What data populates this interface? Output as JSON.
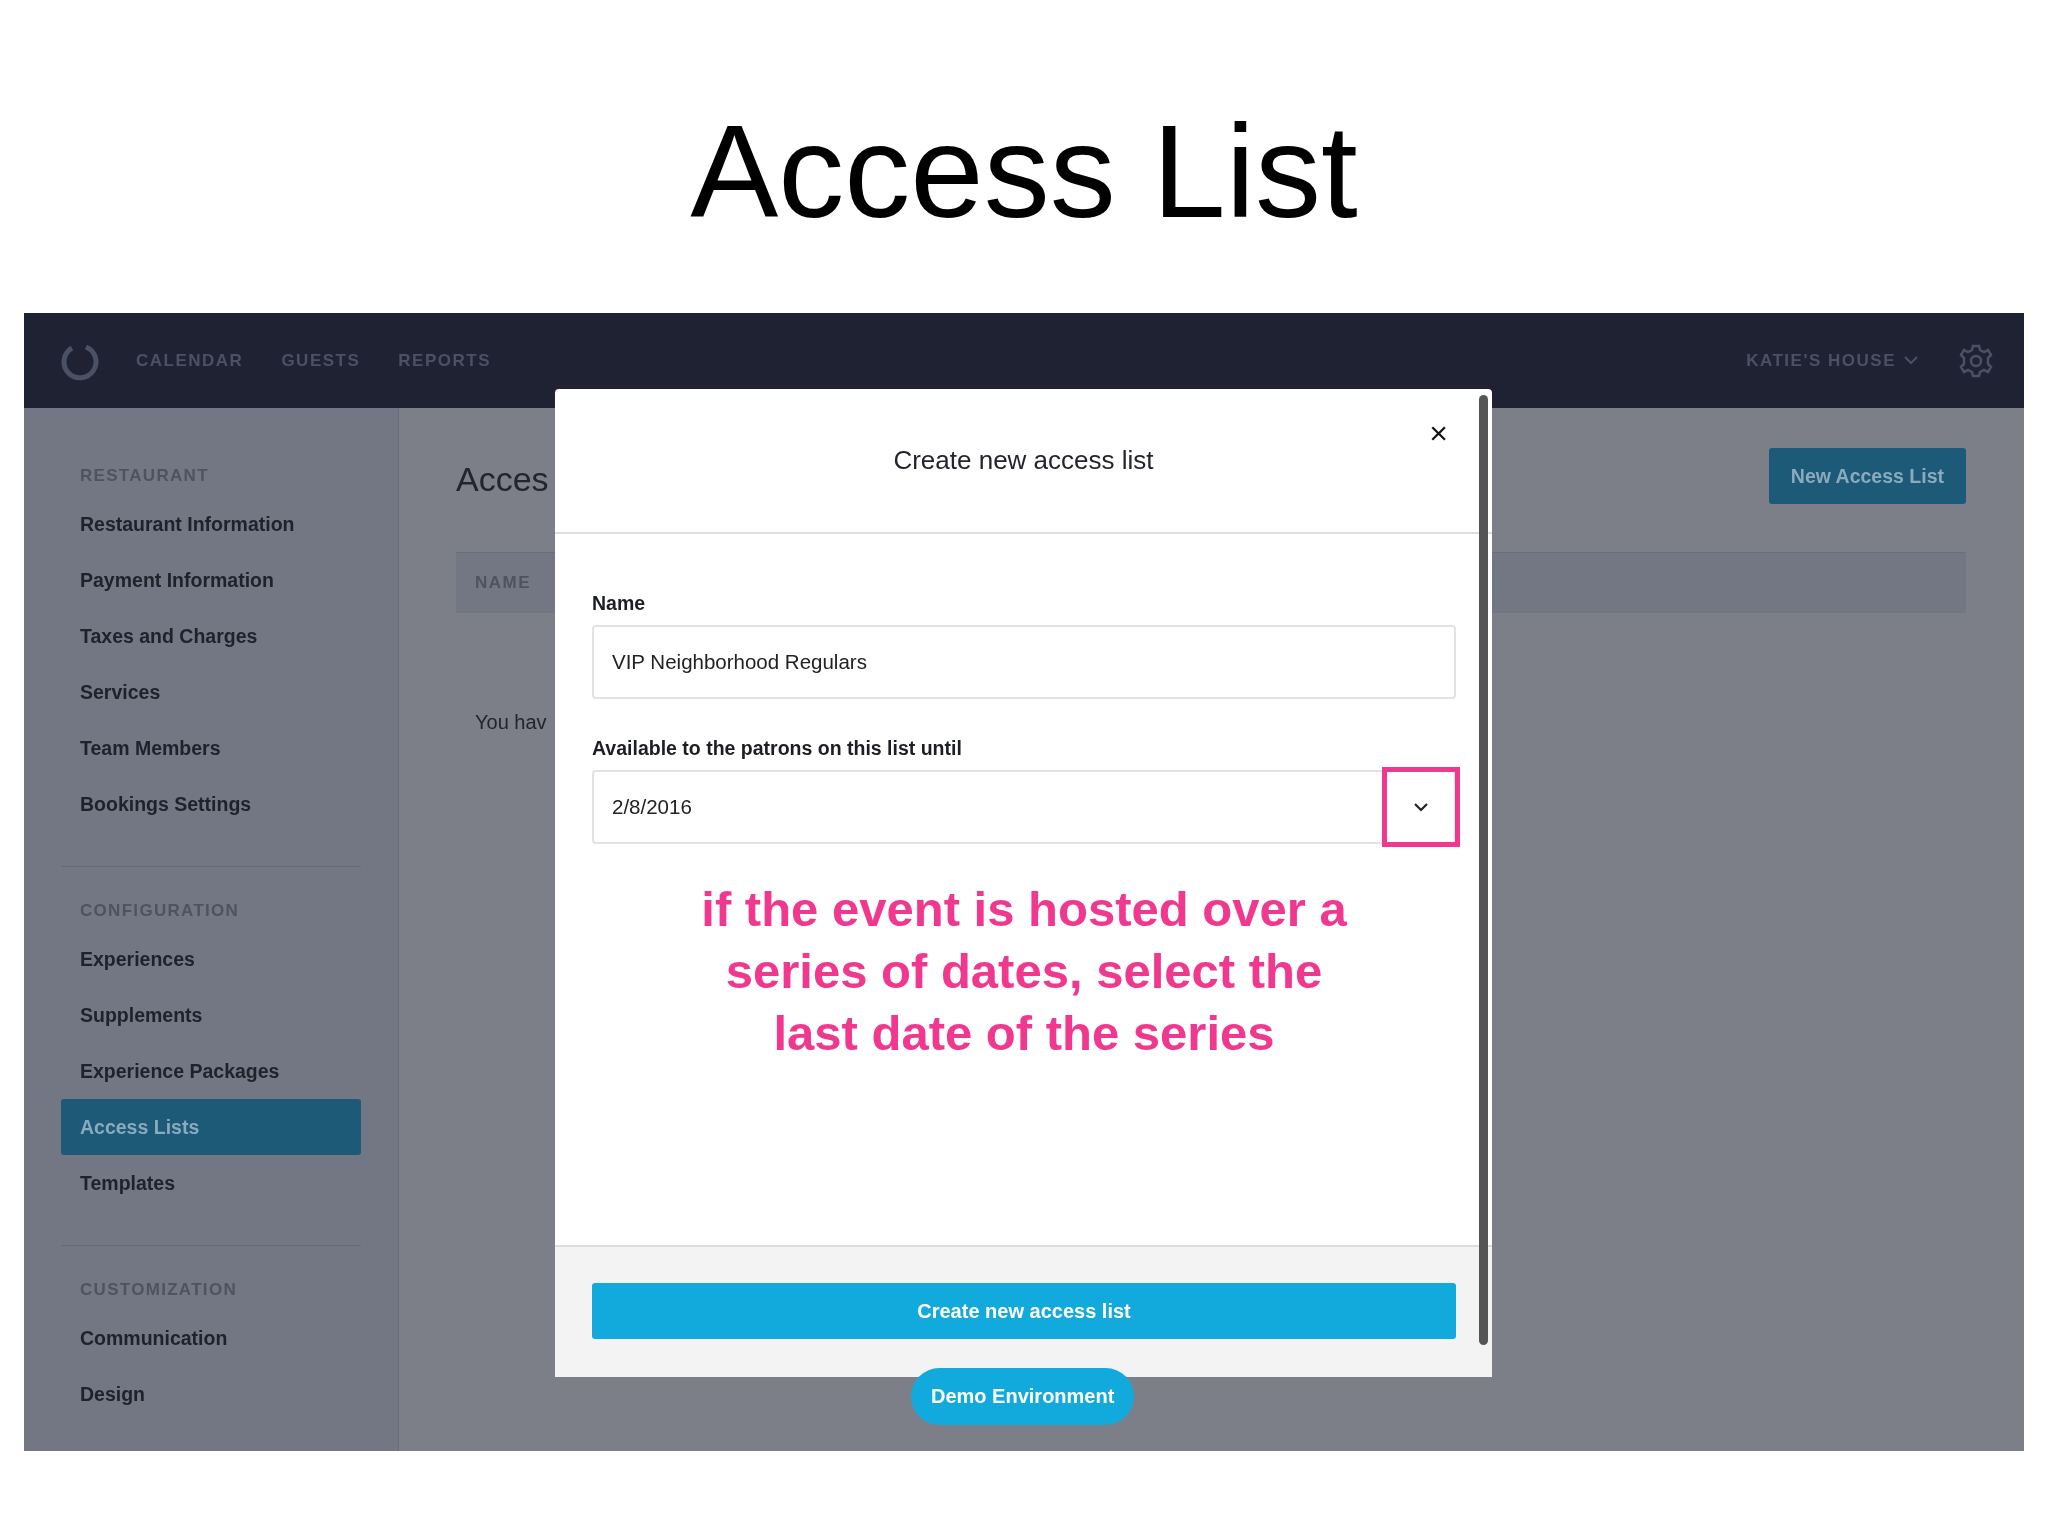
{
  "slide_title": "Access List",
  "topbar": {
    "nav": [
      "CALENDAR",
      "GUESTS",
      "REPORTS"
    ],
    "venue": "KATIE'S HOUSE"
  },
  "sidebar": {
    "sections": [
      {
        "heading": "RESTAURANT",
        "items": [
          {
            "label": "Restaurant Information",
            "selected": false
          },
          {
            "label": "Payment Information",
            "selected": false
          },
          {
            "label": "Taxes and Charges",
            "selected": false
          },
          {
            "label": "Services",
            "selected": false
          },
          {
            "label": "Team Members",
            "selected": false
          },
          {
            "label": "Bookings Settings",
            "selected": false
          }
        ]
      },
      {
        "heading": "CONFIGURATION",
        "items": [
          {
            "label": "Experiences",
            "selected": false
          },
          {
            "label": "Supplements",
            "selected": false
          },
          {
            "label": "Experience Packages",
            "selected": false
          },
          {
            "label": "Access Lists",
            "selected": true
          },
          {
            "label": "Templates",
            "selected": false
          }
        ]
      },
      {
        "heading": "CUSTOMIZATION",
        "items": [
          {
            "label": "Communication",
            "selected": false
          },
          {
            "label": "Design",
            "selected": false
          }
        ]
      }
    ]
  },
  "page": {
    "title": "Acces",
    "new_button": "New Access List",
    "table": {
      "columns": [
        "NAME"
      ]
    },
    "empty_message": "You hav"
  },
  "modal": {
    "title": "Create new access list",
    "close": "×",
    "fields": [
      {
        "kind": "text",
        "label": "Name",
        "value": "VIP Neighborhood Regulars"
      },
      {
        "kind": "dropdown",
        "label": "Available to the patrons on this list until",
        "value": "2/8/2016",
        "highlighted": true
      }
    ],
    "annotation": "if the event is hosted over a\nseries of dates, select the\nlast date of the series",
    "submit": "Create new access list"
  },
  "badge": "Demo Environment"
}
